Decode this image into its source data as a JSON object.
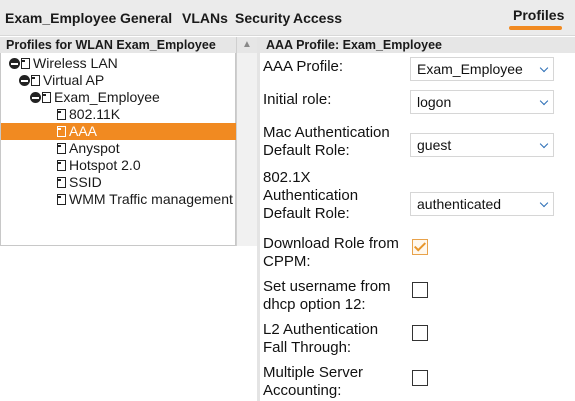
{
  "top_tabs": [
    "Exam_Employee",
    "General",
    "VLANs",
    "Security",
    "Access",
    "Profiles"
  ],
  "left_pane": {
    "header": "Profiles for WLAN Exam_Employee",
    "tree": [
      {
        "label": "Wireless LAN",
        "icon": "minus-icon"
      },
      {
        "label": "Virtual AP",
        "icon": "minus-icon"
      },
      {
        "label": "Exam_Employee",
        "icon": "minus-icon"
      },
      {
        "label": "802.11K",
        "icon": "page-icon"
      },
      {
        "label": "AAA",
        "icon": "page-icon",
        "selected": true
      },
      {
        "label": "Anyspot",
        "icon": "page-icon"
      },
      {
        "label": "Hotspot 2.0",
        "icon": "page-icon"
      },
      {
        "label": "SSID",
        "icon": "page-icon"
      },
      {
        "label": "WMM Traffic management",
        "icon": "page-icon"
      }
    ]
  },
  "right_pane": {
    "header": "AAA Profile: Exam_Employee",
    "fields": [
      {
        "label": "AAA Profile:",
        "type": "select",
        "value": "Exam_Employee"
      },
      {
        "label": "Initial role:",
        "type": "select",
        "value": "logon"
      },
      {
        "label_lines": [
          "Mac Authentication",
          "Default Role:"
        ],
        "type": "select",
        "value": "guest"
      },
      {
        "label_lines": [
          "802.1X",
          "Authentication",
          "Default Role:"
        ],
        "type": "select",
        "value": "authenticated"
      },
      {
        "label_lines": [
          "Download Role from",
          "CPPM:"
        ],
        "type": "checkbox",
        "checked": true
      },
      {
        "label_lines": [
          "Set username from",
          "dhcp option 12:"
        ],
        "type": "checkbox",
        "checked": false
      },
      {
        "label_lines": [
          "L2 Authentication",
          "Fall Through:"
        ],
        "type": "checkbox",
        "checked": false
      },
      {
        "label_lines": [
          "Multiple Server",
          "Accounting:"
        ],
        "type": "checkbox",
        "checked": false
      }
    ]
  },
  "colors": {
    "accent": "#f18a21",
    "chevron": "#2a6db5",
    "header_bg": "#e6e6e6",
    "topbar_bg": "#ebebeb"
  }
}
